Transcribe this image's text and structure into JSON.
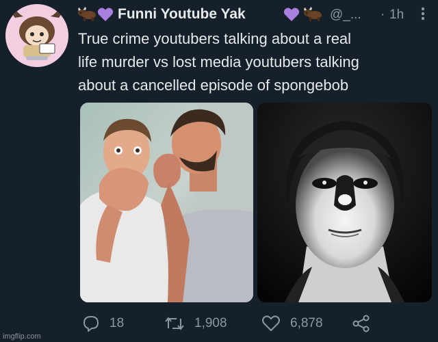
{
  "tweet": {
    "display_name": "Funni Youtube Yak",
    "handle": "@_...",
    "separator": "·",
    "time": "1h",
    "text_lines": [
      "True crime youtubers talking about a real",
      "life murder vs lost media youtubers talking",
      "about a cancelled episode of spongebob"
    ],
    "name_emojis": [
      "yak-emoji",
      "purple-heart-emoji",
      "purple-heart-emoji",
      "yak-emoji"
    ]
  },
  "actions": {
    "replies": "18",
    "retweets": "1,908",
    "likes": "6,878"
  },
  "watermark": "imgflip.com",
  "colors": {
    "background": "#15202b",
    "text": "#e7e9ea",
    "secondary": "#8b98a5",
    "heart": "#a97fe0"
  }
}
